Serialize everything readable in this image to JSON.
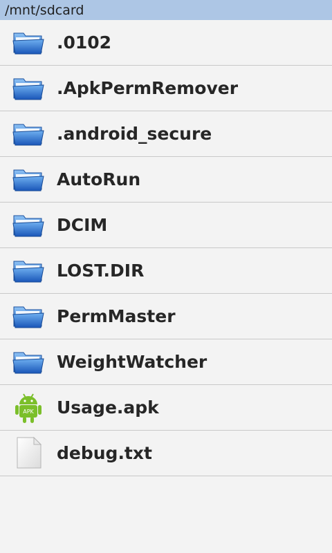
{
  "path_bar": {
    "path": "/mnt/sdcard"
  },
  "files": [
    {
      "name": ".0102",
      "icon": "folder-icon"
    },
    {
      "name": ".ApkPermRemover",
      "icon": "folder-icon"
    },
    {
      "name": ".android_secure",
      "icon": "folder-icon"
    },
    {
      "name": "AutoRun",
      "icon": "folder-icon"
    },
    {
      "name": "DCIM",
      "icon": "folder-icon"
    },
    {
      "name": "LOST.DIR",
      "icon": "folder-icon"
    },
    {
      "name": "PermMaster",
      "icon": "folder-icon"
    },
    {
      "name": "WeightWatcher",
      "icon": "folder-icon"
    },
    {
      "name": "Usage.apk",
      "icon": "android-apk-icon",
      "icon_label": "APK"
    },
    {
      "name": "debug.txt",
      "icon": "text-file-icon"
    }
  ],
  "colors": {
    "path_bar_bg": "#adc6e5",
    "folder_blue": "#2f7fd8",
    "android_green": "#7bbf2a",
    "background": "#f3f3f3"
  }
}
